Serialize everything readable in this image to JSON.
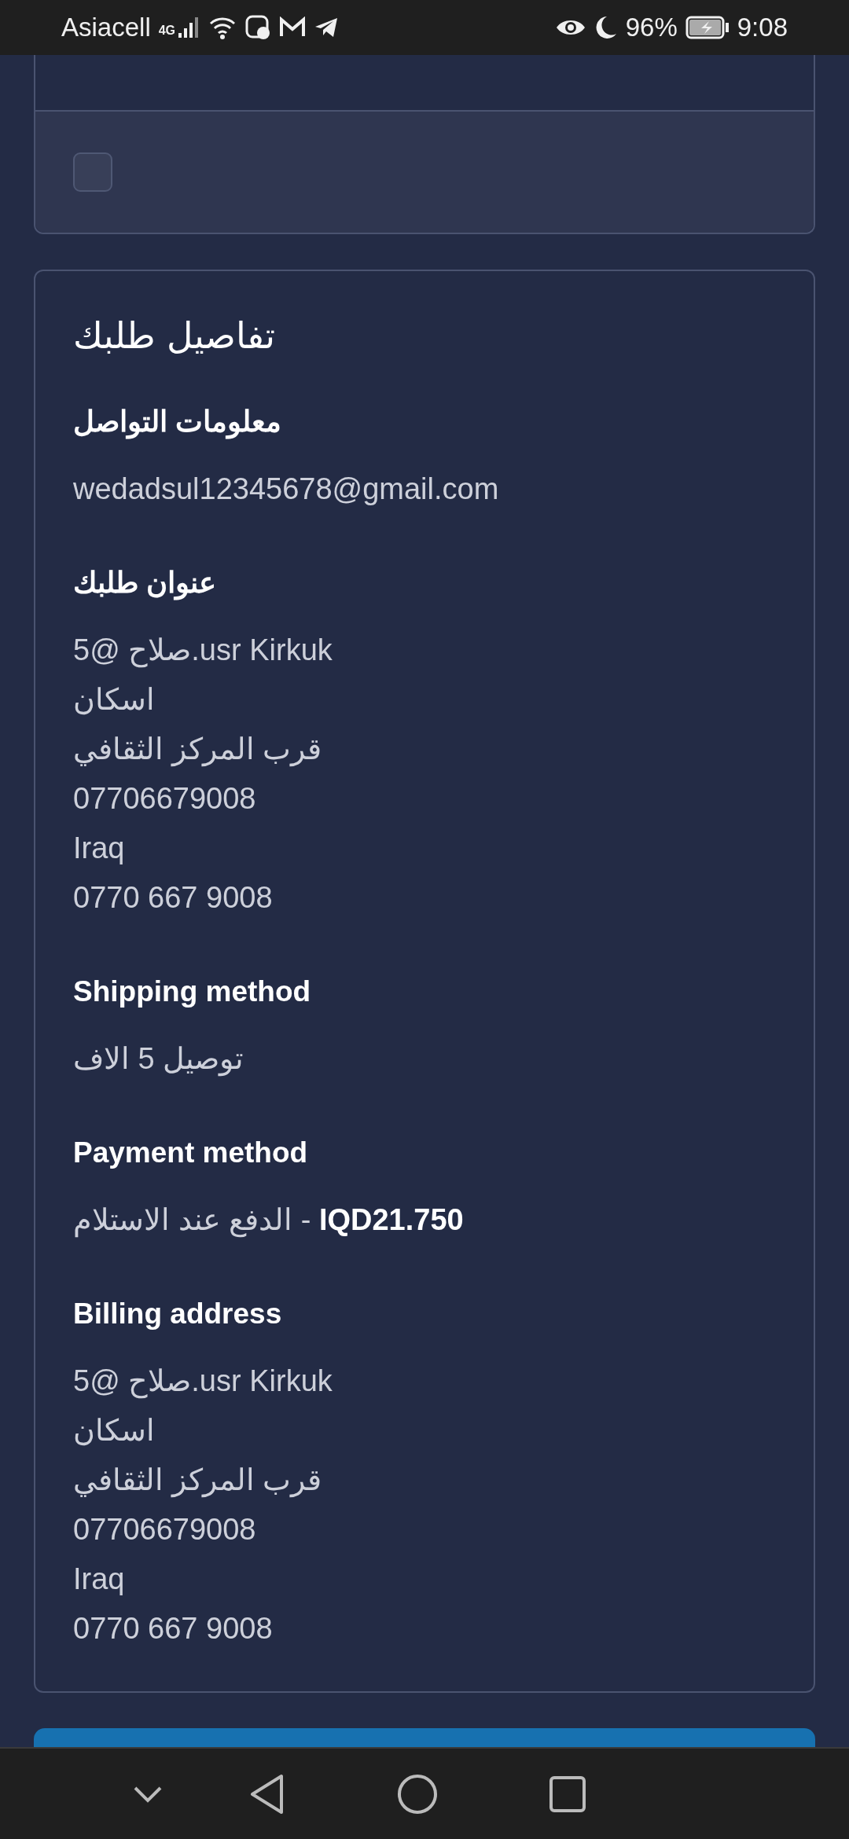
{
  "status_bar": {
    "carrier": "Asiacell",
    "network": "4G",
    "battery": "96%",
    "time": "9:08"
  },
  "consent_card": {
    "checkbox": {
      "checked": false
    }
  },
  "order_details": {
    "title": "تفاصيل طلبك",
    "sections": [
      {
        "heading": "معلومات التواصل",
        "lines": [
          "wedadsul12345678@gmail.com"
        ]
      },
      {
        "heading": "عنوان طلبك",
        "lines": [
          "5@ صلاح.usr Kirkuk",
          "اسكان",
          "قرب المركز الثقافي",
          "07706679008",
          "Iraq",
          "0770 667 9008"
        ]
      },
      {
        "heading": "Shipping method",
        "lines": [
          "توصيل 5 الاف"
        ]
      },
      {
        "heading": "Payment method",
        "lines": [
          "الدفع عند الاستلام - **IQD21.750**"
        ]
      },
      {
        "heading": "Billing address",
        "lines": [
          "5@ صلاح.usr Kirkuk",
          "اسكان",
          "قرب المركز الثقافي",
          "07706679008",
          "Iraq",
          "0770 667 9008"
        ]
      }
    ]
  }
}
